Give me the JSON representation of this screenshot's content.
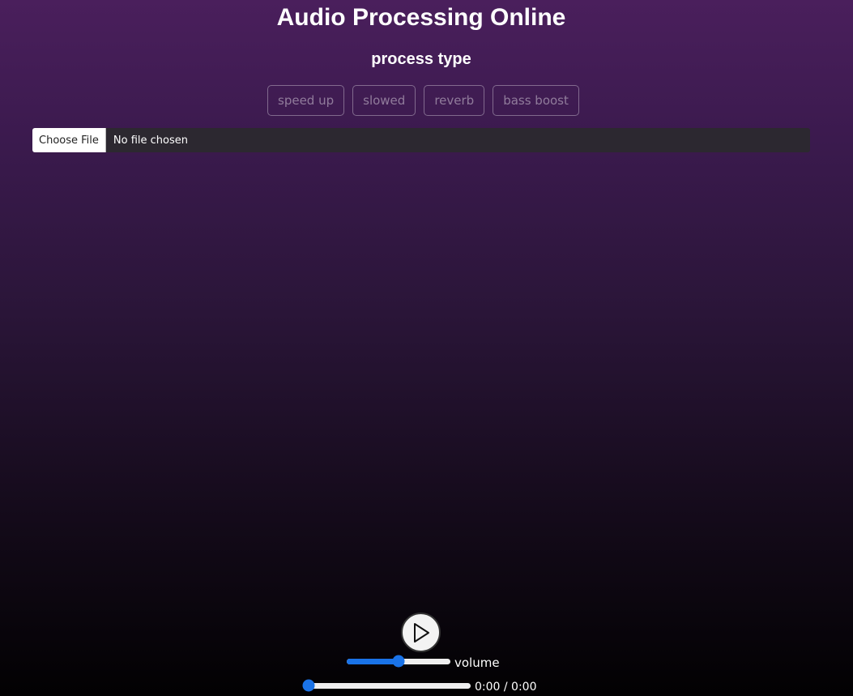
{
  "app": {
    "title": "Audio Processing Online"
  },
  "process": {
    "heading": "process type",
    "buttons": [
      {
        "label": "speed up"
      },
      {
        "label": "slowed"
      },
      {
        "label": "reverb"
      },
      {
        "label": "bass boost"
      }
    ]
  },
  "file_input": {
    "button_label": "Choose File",
    "status": "No file chosen"
  },
  "player": {
    "play_icon": "play-icon",
    "volume_label": "volume",
    "volume_level": 0.5,
    "seek_position": 0,
    "time_display": "0:00 / 0:00",
    "accent_color": "#1a73e8"
  }
}
